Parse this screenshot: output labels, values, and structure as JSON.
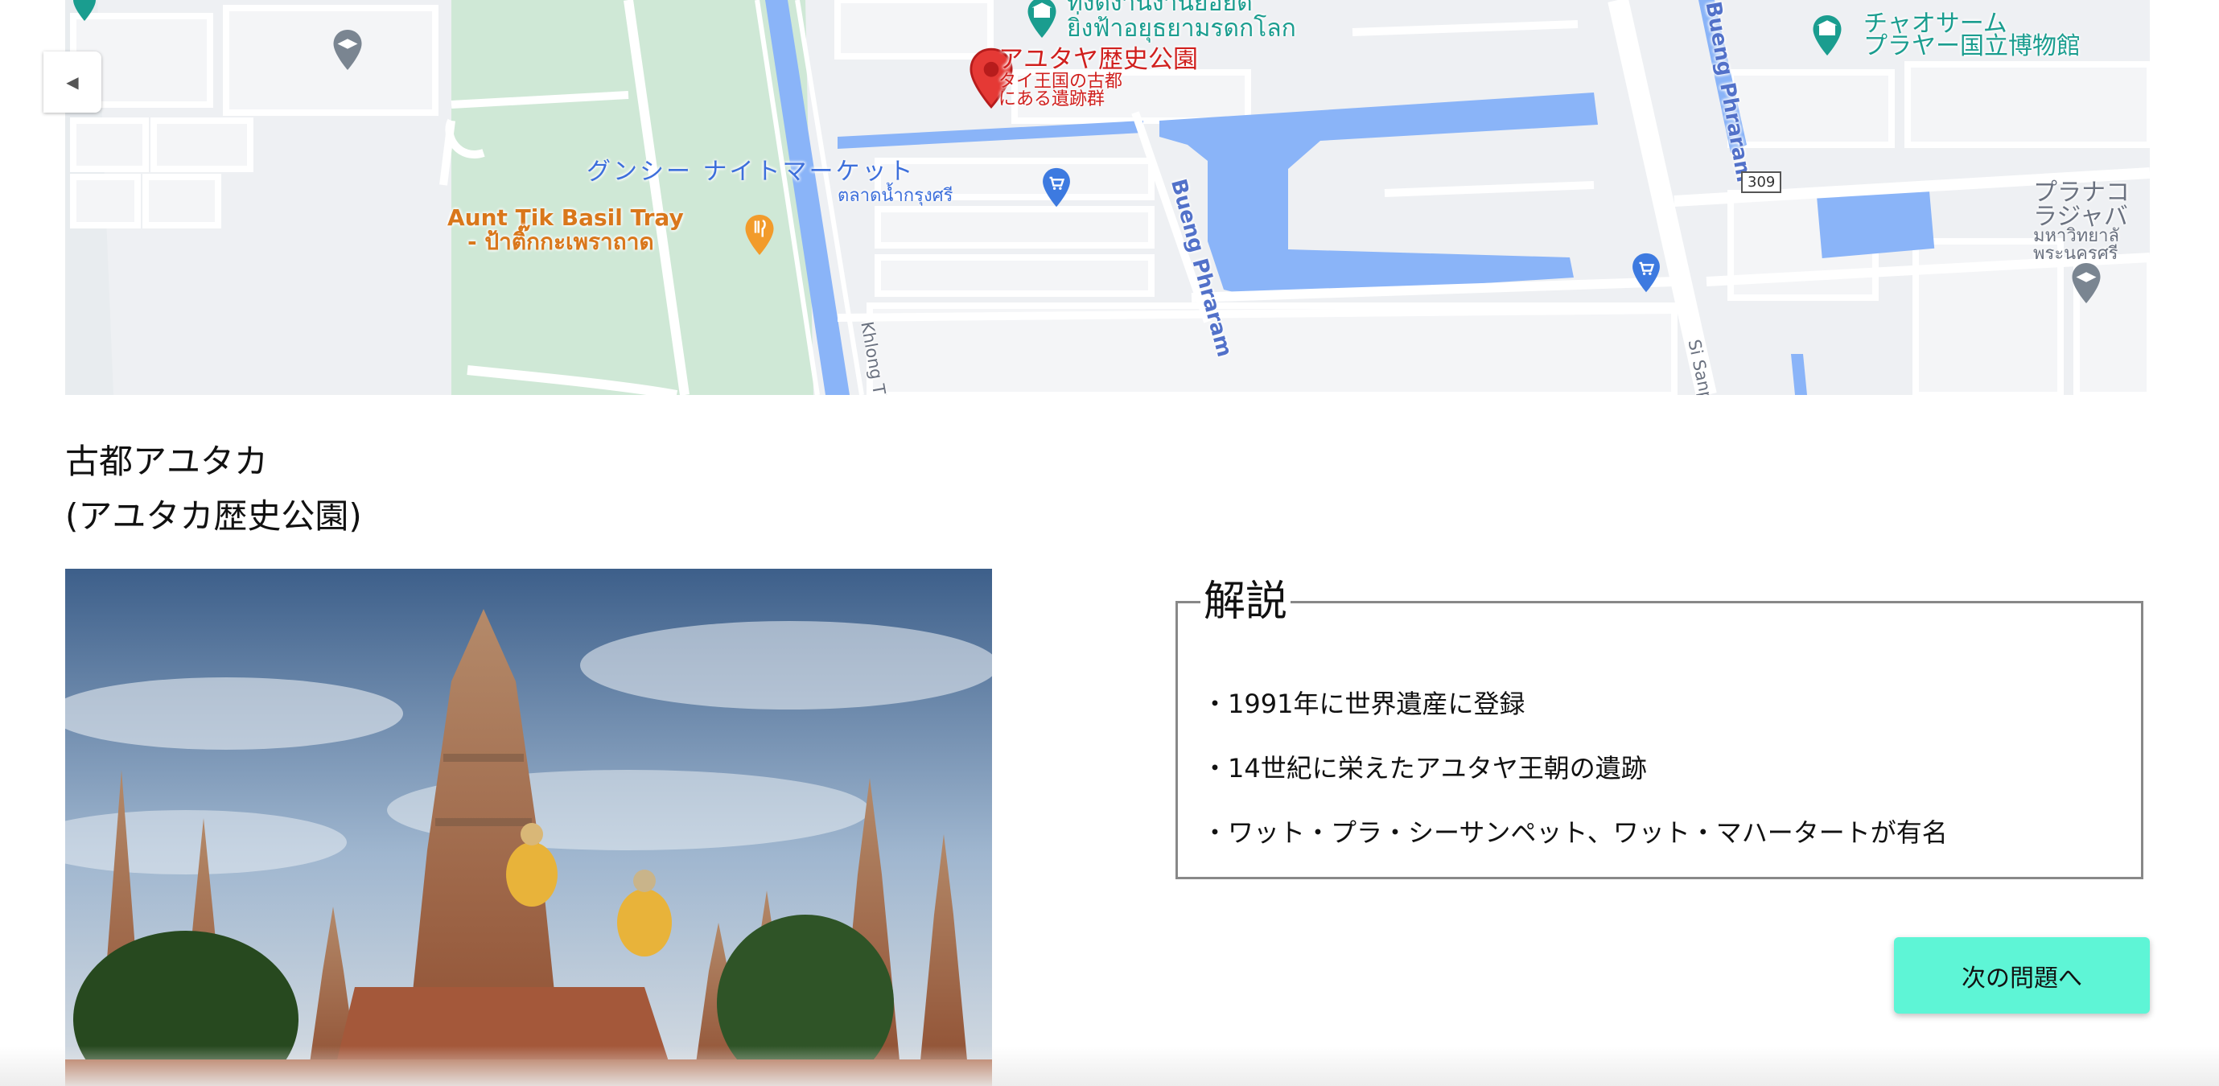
{
  "map": {
    "labels": {
      "main_pin_title": "アユタヤ歴史公園",
      "main_pin_sub1": "タイ王国の古都",
      "main_pin_sub2": "にある遺跡群",
      "thai_top1": "ทงตงานงานยอยต",
      "thai_top2": "ยิ่งฟ้าอยุธยามรดกโลก",
      "museum1": "チャオサーム",
      "museum2": "プラヤー国立博物館",
      "market_jp": "グンシー ナイトマーケット",
      "market_th": "ตลาดน้ำกรุงศรี",
      "restaurant1": "Aunt Tik Basil Tray",
      "restaurant2": "- ป้าติ๊กกะเพราถาด",
      "bueng_phraram_1": "Bueng Phraram",
      "bueng_phraram_2": "Bueng Phraram",
      "route_309": "309",
      "khlong": "Khlong Tho",
      "si_sanphet": "Si Sanp",
      "right_jp1": "プラナコ",
      "right_jp2": "ラジャバ",
      "right_th1": "มหาวิทยาลั",
      "right_th2": "พระนครศรี"
    },
    "collapse_glyph": "◀"
  },
  "title": {
    "line1": "古都アユタカ",
    "line2": "(アユタカ歴史公園)"
  },
  "explanation": {
    "legend": "解説",
    "items": [
      "・1991年に世界遺産に登録",
      "・14世紀に栄えたアユタヤ王朝の遺跡",
      "・ワット・プラ・シーサンペット、ワット・マハータートが有名"
    ]
  },
  "next_button": {
    "label": "次の問題へ"
  },
  "colors": {
    "button": "#5ef5d6",
    "water": "#8ab4f8",
    "park": "#cfe8d6",
    "pin_red": "#e53935",
    "teal_icon": "#1a9d8f"
  }
}
